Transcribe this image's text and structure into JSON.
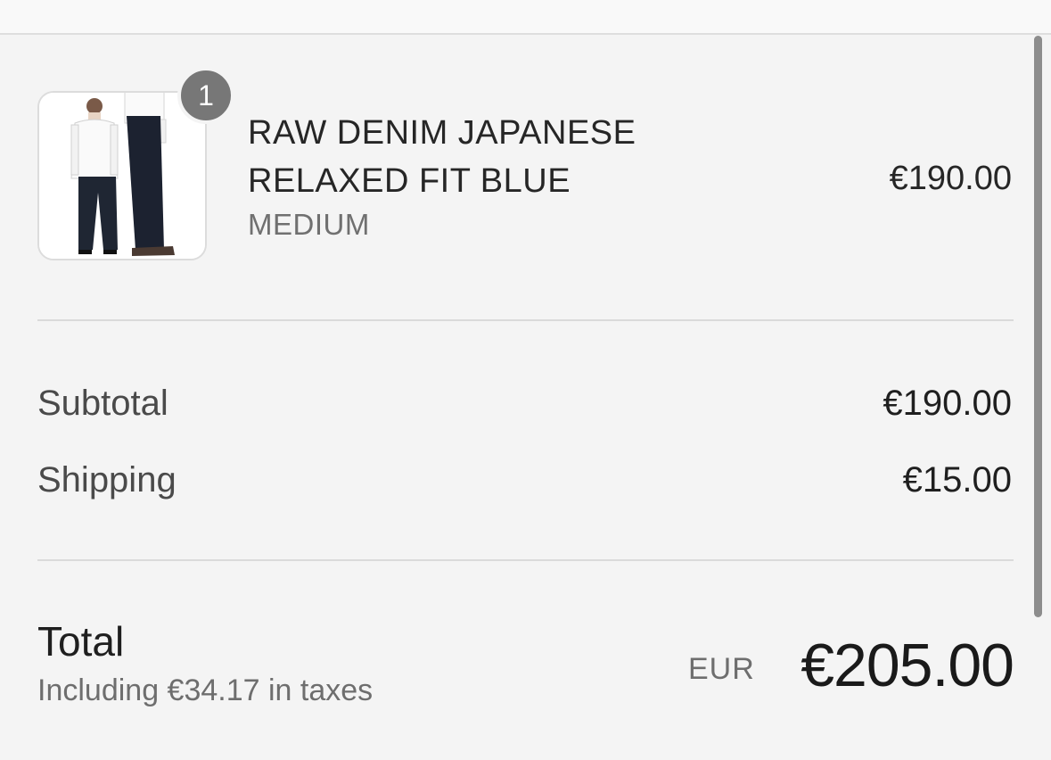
{
  "cart": {
    "item": {
      "quantity": "1",
      "name_line1": "RAW DENIM JAPANESE",
      "name_line2": "RELAXED FIT BLUE",
      "variant": "MEDIUM",
      "price": "€190.00",
      "image": "product-photo"
    }
  },
  "summary": {
    "subtotal_label": "Subtotal",
    "subtotal_value": "€190.00",
    "shipping_label": "Shipping",
    "shipping_value": "€15.00",
    "total_label": "Total",
    "tax_note": "Including €34.17 in taxes",
    "currency": "EUR",
    "total_value": "€205.00"
  },
  "colors": {
    "background": "#f4f4f4",
    "badge": "#777777",
    "divider": "#dadada"
  }
}
